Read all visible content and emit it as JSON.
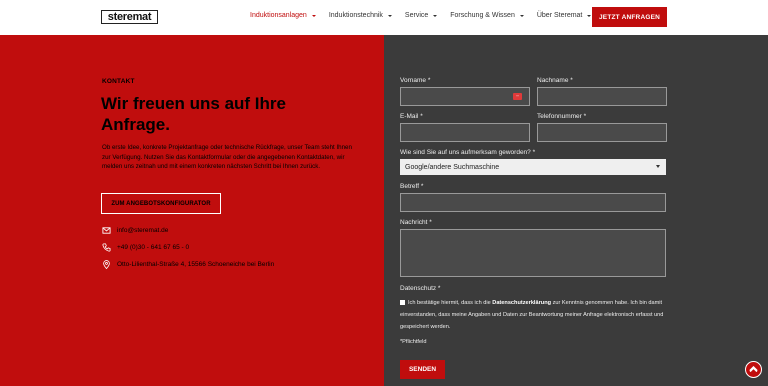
{
  "nav": {
    "logo_text": "steremat",
    "items": [
      {
        "label": "Induktionsanlagen",
        "active": true
      },
      {
        "label": "Induktionstechnik",
        "active": false
      },
      {
        "label": "Service",
        "active": false
      },
      {
        "label": "Forschung & Wissen",
        "active": false
      },
      {
        "label": "Über Steremat",
        "active": false
      }
    ],
    "cta_label": "JETZT ANFRAGEN"
  },
  "left": {
    "section_label": "KONTAKT",
    "headline": "Wir freuen uns auf Ihre Anfrage.",
    "intro": "Ob erste Idee, konkrete Projektanfrage oder technische Rückfrage, unser Team steht Ihnen zur Verfügung. Nutzen Sie das Kontaktformular oder die angegebenen Kontaktdaten, wir melden uns zeitnah und mit einem konkreten nächsten Schritt bei Ihnen zurück.",
    "config_button": "ZUM ANGEBOTSKONFIGURATOR",
    "email": "info@steremat.de",
    "phone": "+49 (0)30 - 641 67 65 - 0",
    "address": "Otto-Lilienthal-Straße 4, 15566 Schoeneiche bei Berlin"
  },
  "form": {
    "vorname_label": "Vorname *",
    "nachname_label": "Nachname *",
    "email_label": "E-Mail *",
    "telefon_label": "Telefonnummer *",
    "source_label": "Wie sind Sie auf uns aufmerksam geworden? *",
    "source_selected": "Google/andere Suchmaschine",
    "betreff_label": "Betreff *",
    "nachricht_label": "Nachricht *",
    "datenschutz_label": "Datenschutz *",
    "consent_before": "Ich bestätige hiermit, dass ich die",
    "consent_link": "Datenschutzerklärung",
    "consent_after": "zur Kenntnis genommen habe. Ich bin damit einverstanden, dass meine Angaben und Daten zur Beantwortung meiner Anfrage elektronisch erfasst und gespeichert werden.",
    "pflicht_note": "*Pflichtfeld",
    "submit_label": "SENDEN",
    "autofill_badge": "···"
  },
  "colors": {
    "brand_red": "#c00d0d",
    "form_bg": "#3b3b3b"
  },
  "icons": {
    "email": "envelope-icon",
    "phone": "phone-icon",
    "address": "map-pin-icon",
    "scroll_top": "chevron-up-icon"
  }
}
